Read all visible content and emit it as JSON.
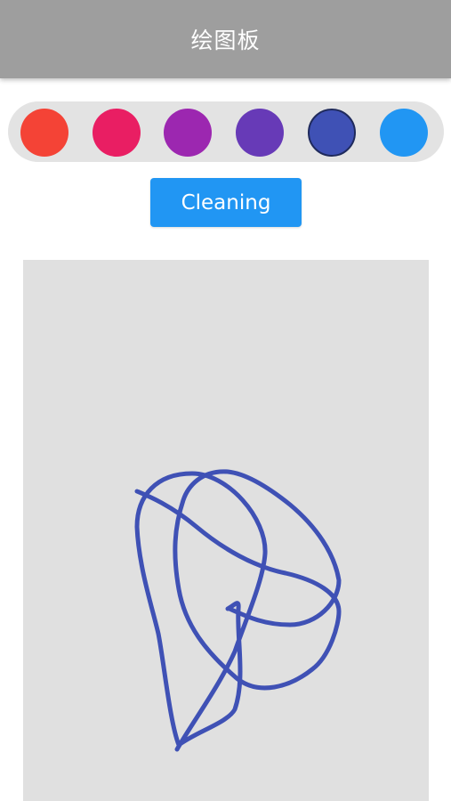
{
  "header": {
    "title": "绘图板"
  },
  "palette": {
    "colors": [
      {
        "name": "red",
        "hex": "#f44336"
      },
      {
        "name": "pink",
        "hex": "#e91e63"
      },
      {
        "name": "purple",
        "hex": "#9c27b0"
      },
      {
        "name": "deep-purple",
        "hex": "#673ab7"
      },
      {
        "name": "indigo",
        "hex": "#3f51b5"
      },
      {
        "name": "blue",
        "hex": "#2196f3"
      }
    ],
    "selected": "indigo"
  },
  "toolbar": {
    "clean_label": "Cleaning"
  },
  "canvas": {
    "background": "#e0e0e0",
    "stroke_color": "#3f51b5"
  }
}
